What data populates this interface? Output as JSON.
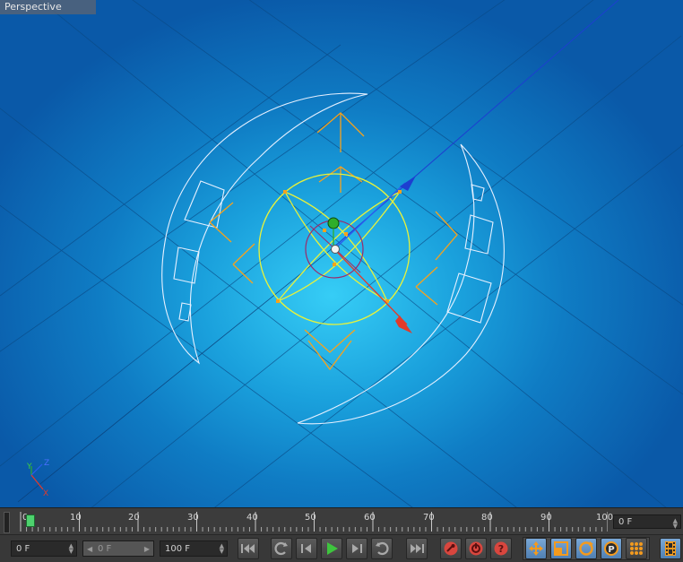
{
  "viewport": {
    "label": "Perspective",
    "axis_labels": {
      "y": "Y",
      "z": "Z",
      "x": "X"
    }
  },
  "timeline": {
    "tick_labels": [
      "0",
      "10",
      "20",
      "30",
      "40",
      "50",
      "60",
      "70",
      "80",
      "90",
      "100"
    ],
    "current_frame_field": "0 F"
  },
  "controls": {
    "start_frame": "0 F",
    "range_start": "0 F",
    "end_frame": "100 F",
    "buttons": [
      "goto-start",
      "prev-key",
      "prev-frame",
      "play",
      "next-frame",
      "next-key",
      "goto-end",
      "record",
      "autokey",
      "keyframe-selection",
      "move-key",
      "scale-key",
      "rotate-key",
      "param-key",
      "pla-key",
      "timeline-window"
    ]
  },
  "colors": {
    "viewport_center": "#36cdf6",
    "viewport_edge": "#0a59a8",
    "wireframe": "#e6f0ff",
    "gizmo_orange": "#f7a21c",
    "gizmo_yellow": "#e8f23a",
    "axis_red": "#e23a2a",
    "axis_blue": "#1d3fd0",
    "axis_green": "#2fae2a",
    "play_green": "#3ec43e",
    "record_red": "#d9463e"
  }
}
